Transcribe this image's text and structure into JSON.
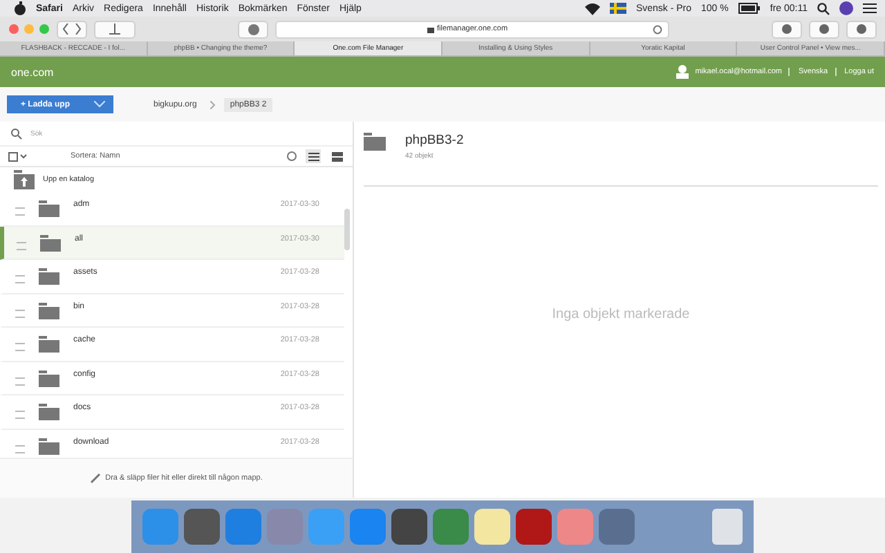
{
  "menu_bar": {
    "app": "Safari",
    "items": [
      "Arkiv",
      "Redigera",
      "Innehåll",
      "Historik",
      "Bokmärken",
      "Fönster",
      "Hjälp"
    ],
    "input_source": "Svensk - Pro",
    "battery": "100 %",
    "clock": "fre 00:11"
  },
  "browser": {
    "address": "filemanager.one.com",
    "tabs": [
      {
        "label": "FLASHBACK - RECCADE - I fol...",
        "selected": false
      },
      {
        "label": "phpBB • Changing the theme?",
        "selected": false
      },
      {
        "label": "One.com File Manager",
        "selected": true
      },
      {
        "label": "Installing & Using Styles",
        "selected": false
      },
      {
        "label": "Yoratic Kapital",
        "selected": false
      },
      {
        "label": "User Control Panel • View mes...",
        "selected": false
      }
    ]
  },
  "header": {
    "logo": "one.com",
    "user": "mikael.ocal@hotmail.com",
    "language": "Svenska",
    "logout": "Logga ut"
  },
  "toolbar": {
    "upload": "+ Ladda upp",
    "breadcrumbs": [
      {
        "label": "bigkupu.org",
        "selected": false
      },
      {
        "label": "phpBB3 2",
        "selected": true
      }
    ]
  },
  "file_list": {
    "search_placeholder": "Sök",
    "sort": "Sortera: Namn",
    "up": "Upp en katalog",
    "rows": [
      {
        "name": "adm",
        "date": "2017-03-30",
        "selected": false
      },
      {
        "name": "all",
        "date": "2017-03-30",
        "selected": true
      },
      {
        "name": "assets",
        "date": "2017-03-28",
        "selected": false
      },
      {
        "name": "bin",
        "date": "2017-03-28",
        "selected": false
      },
      {
        "name": "cache",
        "date": "2017-03-28",
        "selected": false
      },
      {
        "name": "config",
        "date": "2017-03-28",
        "selected": false
      },
      {
        "name": "docs",
        "date": "2017-03-28",
        "selected": false
      },
      {
        "name": "download",
        "date": "2017-03-28",
        "selected": false
      }
    ],
    "drop_hint": "Dra & släpp filer hit eller direkt till någon mapp."
  },
  "details": {
    "title": "phpBB3-2",
    "count": "42 objekt",
    "empty": "Inga objekt markerade"
  }
}
